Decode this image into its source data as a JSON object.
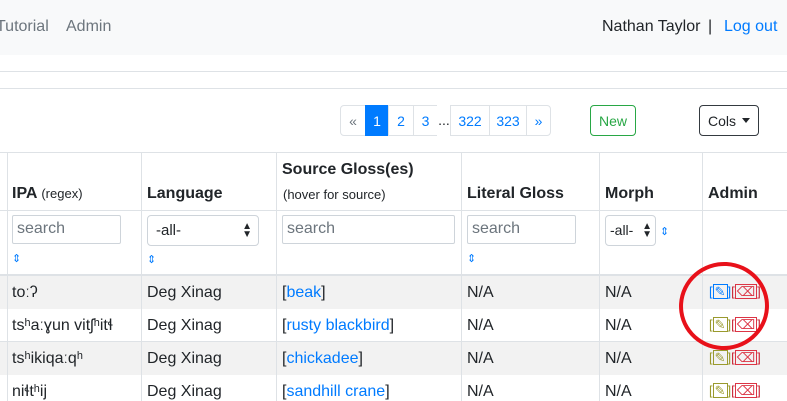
{
  "nav": {
    "links": [
      "Tutorial",
      "Admin"
    ],
    "user": "Nathan Taylor",
    "separator": "|",
    "logout": "Log out"
  },
  "pagination": {
    "prev": "«",
    "pages": [
      "1",
      "2",
      "3"
    ],
    "ellipsis": "...",
    "late_pages": [
      "322",
      "323"
    ],
    "next": "»",
    "active": "1"
  },
  "toolbar": {
    "new_label": "New",
    "cols_label": "Cols"
  },
  "table": {
    "columns": [
      {
        "label": "IPA",
        "note": "(regex)"
      },
      {
        "label": "Language"
      },
      {
        "label": "Source Gloss(es)",
        "note": "(hover for source)"
      },
      {
        "label": "Literal Gloss"
      },
      {
        "label": "Morph"
      },
      {
        "label": "Admin"
      }
    ],
    "filters": {
      "ipa_placeholder": "search",
      "language_value": "-all-",
      "gloss_placeholder": "search",
      "literal_placeholder": "search",
      "morph_value": "-all-"
    },
    "sort_icon": "⇕",
    "rows": [
      {
        "ipa": "toːʔ",
        "language": "Deg Xinag",
        "gloss": "beak",
        "literal": "N/A",
        "morph": "N/A"
      },
      {
        "ipa": "tsʰaːɣun vitʃʰitɬ",
        "language": "Deg Xinag",
        "gloss": "rusty blackbird",
        "literal": "N/A",
        "morph": "N/A"
      },
      {
        "ipa": "tsʰikiqaːqʰ",
        "language": "Deg Xinag",
        "gloss": "chickadee",
        "literal": "N/A",
        "morph": "N/A"
      },
      {
        "ipa": "niɬtʰij",
        "language": "Deg Xinag",
        "gloss": "sandhill crane",
        "literal": "N/A",
        "morph": "N/A"
      }
    ],
    "edit_icon": "✎",
    "delete_icon": "⌫"
  },
  "colors": {
    "primary": "#007bff",
    "success": "#28a745",
    "danger": "#dc3545",
    "annotation": "#e8111a"
  }
}
